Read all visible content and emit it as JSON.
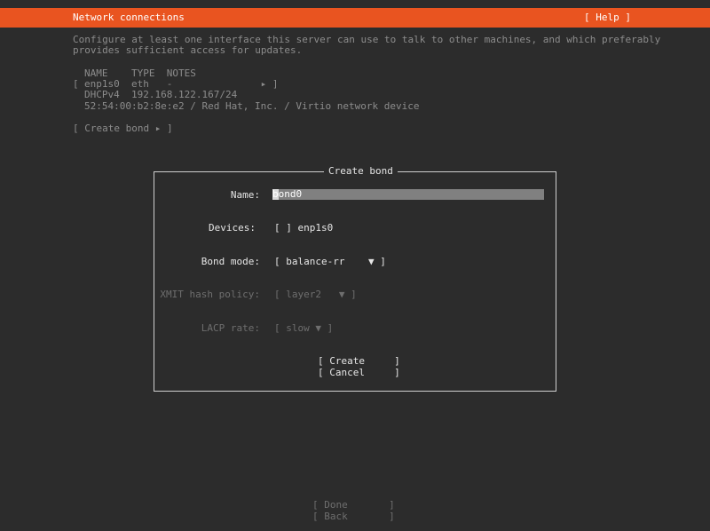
{
  "header": {
    "title": "Network connections",
    "help": "[ Help ]"
  },
  "intro": {
    "line1": "Configure at least one interface this server can use to talk to other machines, and which preferably",
    "line2": "provides sufficient access for updates."
  },
  "table": {
    "header": "NAME    TYPE  NOTES",
    "row_open": "[",
    "row_main": "enp1s0  eth   -               ▸ ]",
    "detail1": "DHCPv4  192.168.122.167/24",
    "detail2": "52:54:00:b2:8e:e2 / Red Hat, Inc. / Virtio network device"
  },
  "create_bond_link": "[ Create bond ▸ ]",
  "dialog": {
    "title": "Create bond",
    "name_label": "Name:",
    "name_value": "bond0",
    "devices_label": "Devices:",
    "devices_value": "[ ] enp1s0",
    "bond_mode_label": "Bond mode:",
    "bond_mode_value": "[ balance-rr    ▼ ]",
    "xmit_label": "XMIT hash policy:",
    "xmit_value": "[ layer2   ▼ ]",
    "lacp_label": "LACP rate:",
    "lacp_value": "[ slow ▼ ]",
    "create_button": "[ Create     ]",
    "cancel_button": "[ Cancel     ]"
  },
  "footer": {
    "done_button": "[ Done       ]",
    "back_button": "[ Back       ]"
  },
  "colors": {
    "accent": "#e95420",
    "background": "#2c2c2c"
  }
}
